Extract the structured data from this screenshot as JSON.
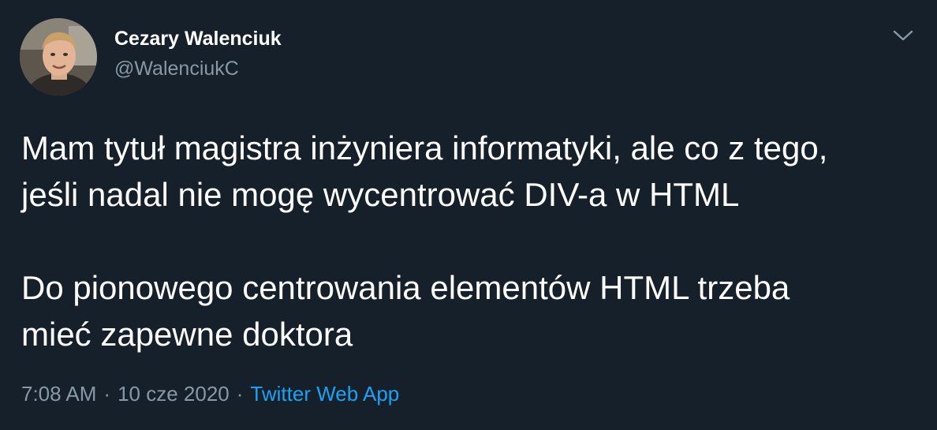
{
  "author": {
    "display_name": "Cezary Walenciuk",
    "handle": "@WalenciukC",
    "avatar_icon": "user-avatar"
  },
  "menu": {
    "icon": "chevron-down-icon"
  },
  "tweet": {
    "paragraphs": [
      {
        "lines": [
          "Mam tytuł magistra inżyniera informatyki, ale co z tego,",
          "jeśli nadal nie mogę wycentrować DIV-a w HTML"
        ]
      },
      {
        "lines": [
          "Do pionowego centrowania elementów HTML trzeba",
          "mieć zapewne doktora"
        ]
      }
    ]
  },
  "meta": {
    "time": "7:08 AM",
    "separator": "·",
    "date": "10 cze 2020",
    "source": "Twitter Web App"
  },
  "colors": {
    "background": "#15202b",
    "text": "#ffffff",
    "secondary_text": "#8899a6",
    "link": "#1da1f2"
  }
}
